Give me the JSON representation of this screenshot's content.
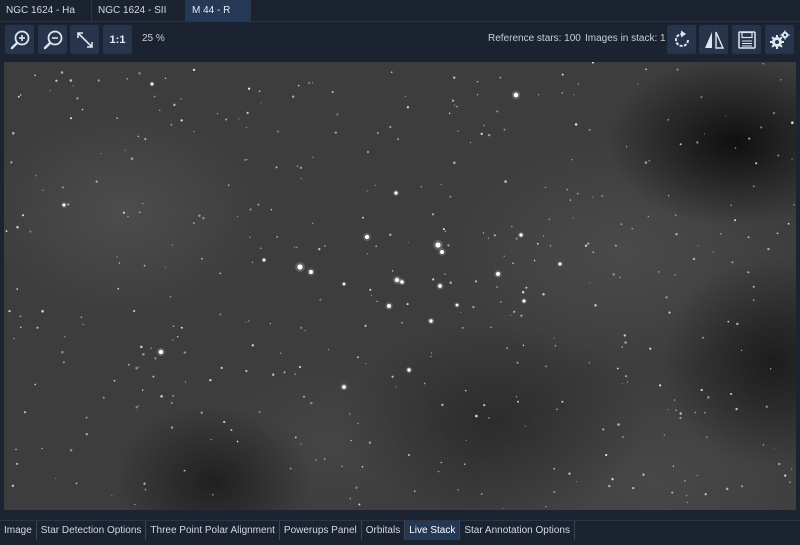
{
  "doc_tabs": [
    {
      "label": "NGC 1624 - Ha"
    },
    {
      "label": "NGC 1624 - SII"
    },
    {
      "label": "M 44 - R",
      "active": true
    }
  ],
  "toolbar": {
    "zoom_in_icon": "zoom-in-icon",
    "zoom_out_icon": "zoom-out-icon",
    "fit_icon": "fit-diagonal-icon",
    "one_to_one_label": "1:1",
    "zoom_level": "25 %",
    "reference_stars": "Reference stars: 100",
    "images_in_stack": "Images in stack: 1",
    "rotate_icon": "rotate-icon",
    "flip_icon": "flip-icon",
    "save_icon": "save-icon",
    "settings_icon": "gear-icon"
  },
  "viewer": {
    "image": "star-field-m44"
  },
  "panel_tabs": [
    {
      "label": "Image"
    },
    {
      "label": "Star Detection Options"
    },
    {
      "label": "Three Point Polar Alignment"
    },
    {
      "label": "Powerups Panel"
    },
    {
      "label": "Orbitals"
    },
    {
      "label": "Live Stack",
      "active": true
    },
    {
      "label": "Star Annotation Options"
    }
  ],
  "colors": {
    "background": "#1b2230",
    "button": "#26354b",
    "active_tab": "#233956",
    "icon": "#dfe6ee"
  }
}
